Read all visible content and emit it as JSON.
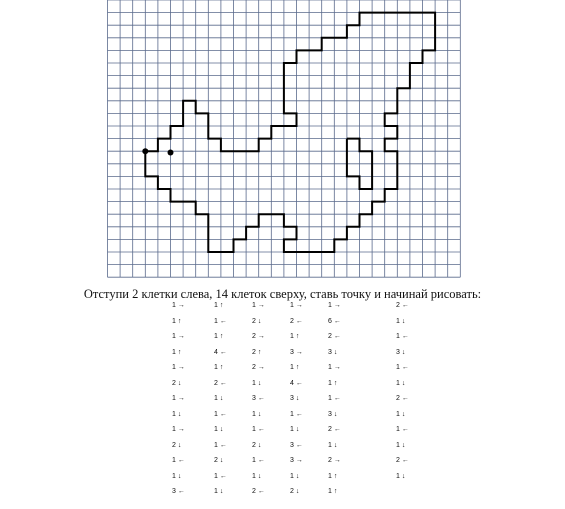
{
  "instruction": "Отступи 2 клетки слева, 14 клеток сверху, ставь точку и начинай рисовать:",
  "colors": {
    "grid_line": "#5a6a8c",
    "drawing": "#000000"
  },
  "steps": [
    [
      "1 →",
      "1 ↑",
      "1 →",
      "1 →",
      "1 →",
      "2 ←"
    ],
    [
      "1 ↑",
      "1 ←",
      "2 ↓",
      "2 ←",
      "6 ←",
      "1 ↓"
    ],
    [
      "1 →",
      "1 ↑",
      "2 →",
      "1 ↑",
      "2 ←",
      "1 ←"
    ],
    [
      "1 ↑",
      "4 ←",
      "2 ↑",
      "3 →",
      "3 ↓",
      "3 ↓"
    ],
    [
      "1 →",
      "1 ↑",
      "2 →",
      "1 ↑",
      "1 →",
      "1 ←"
    ],
    [
      "2 ↓",
      "2 ←",
      "1 ↓",
      "4 ←",
      "1 ↑",
      "1 ↓"
    ],
    [
      "1 →",
      "1 ↓",
      "3 ←",
      "3 ↓",
      "1 ←",
      "2 ←"
    ],
    [
      "1 ↓",
      "1 ←",
      "1 ↓",
      "1 ←",
      "3 ↓",
      "1 ↓"
    ],
    [
      "1 →",
      "1 ↓",
      "1 ←",
      "1 ↓",
      "2 ←",
      "1 ←"
    ],
    [
      "2 ↓",
      "1 ←",
      "2 ↓",
      "3 ←",
      "1 ↓",
      "1 ↓"
    ],
    [
      "1 ←",
      "2 ↓",
      "1 ←",
      "3 →",
      "2 →",
      "2 ←"
    ],
    [
      "1 ↓",
      "1 ←",
      "1 ↓",
      "1 ↓",
      "1 ↑",
      "1 ↓"
    ],
    [
      "3 ←",
      "1 ↓",
      "2 ←",
      "2 ↓",
      "1 ↑",
      ""
    ]
  ]
}
